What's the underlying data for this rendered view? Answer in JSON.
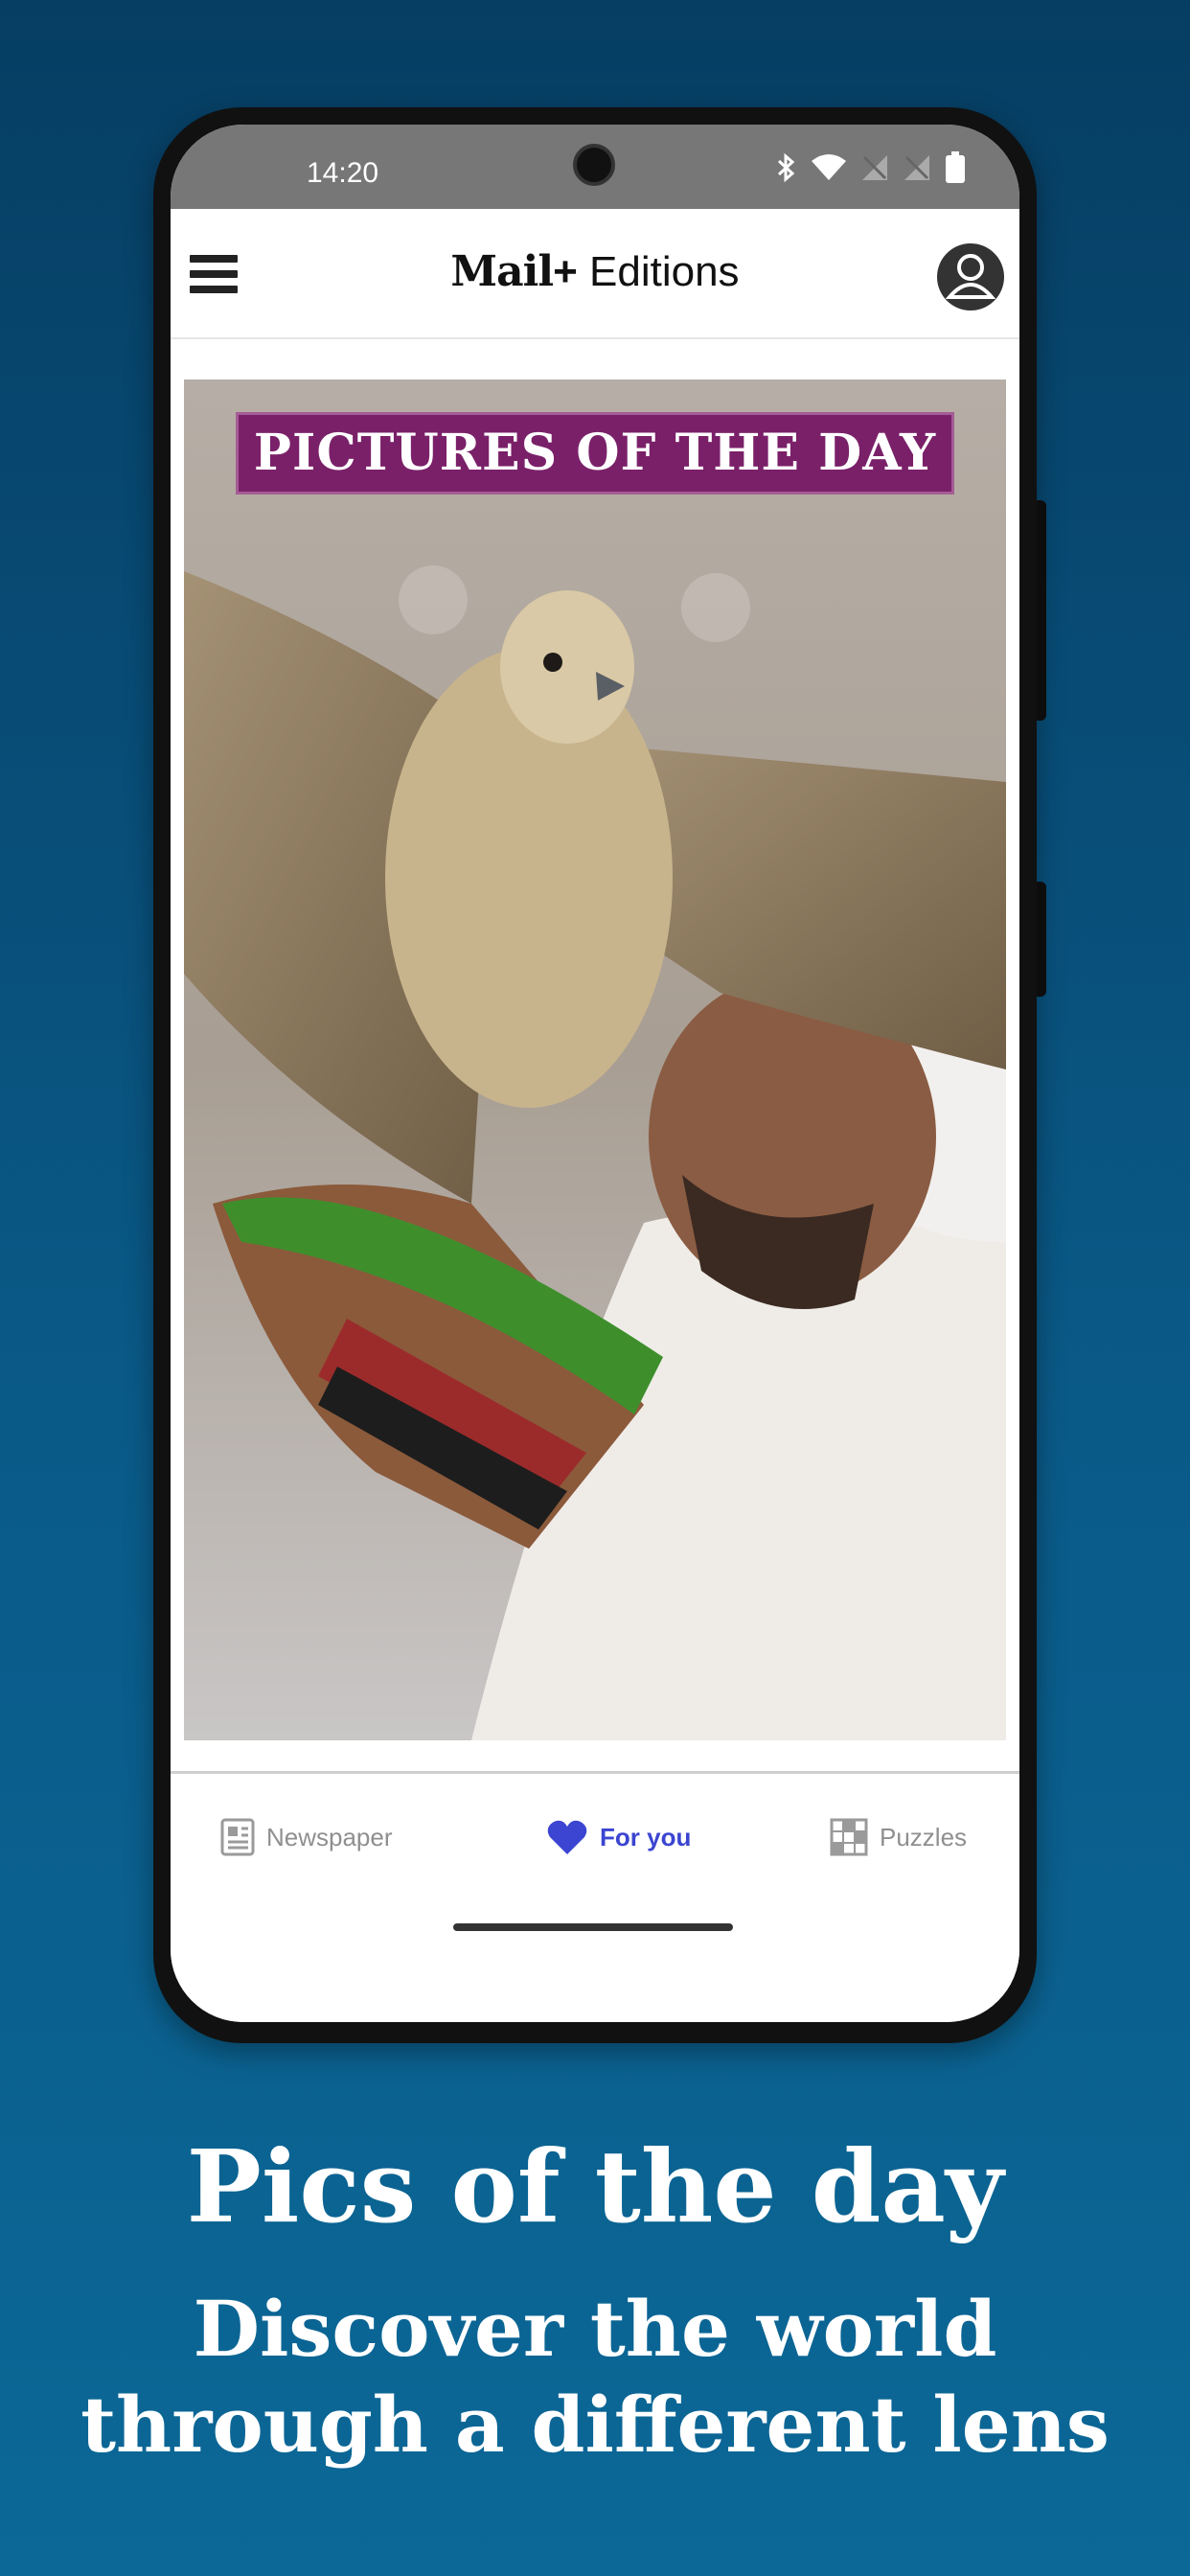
{
  "status_bar": {
    "time": "14:20"
  },
  "app_bar": {
    "brand_mail": "Mail",
    "brand_plus": "+",
    "brand_editions": "Editions"
  },
  "content": {
    "banner": "PICTURES OF THE DAY"
  },
  "tabs": [
    {
      "label": "Newspaper",
      "icon": "newspaper-icon"
    },
    {
      "label": "For you",
      "icon": "heart-icon",
      "active": true
    },
    {
      "label": "Puzzles",
      "icon": "puzzle-grid-icon"
    }
  ],
  "promo": {
    "headline": "Pics of the day",
    "subline_1": "Discover the world",
    "subline_2": "through a different lens"
  },
  "colors": {
    "background": "#0a5a88",
    "banner": "#7a2069",
    "active_tab": "#3b45d1"
  }
}
